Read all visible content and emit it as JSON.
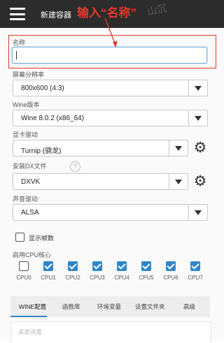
{
  "appbar": {
    "title": "新建容器",
    "annotation": "输入“名称”",
    "watermark": "山沉"
  },
  "name": {
    "label": "名称",
    "value": ""
  },
  "resolution": {
    "label": "屏幕分辨率",
    "value": "800x600 (4:3)"
  },
  "wine": {
    "label": "Wine版本",
    "value": "Wine 8.0.2 (x86_64)"
  },
  "gpu": {
    "label": "显卡驱动",
    "value": "Turnip (骁龙)"
  },
  "dx": {
    "label": "安装DX文件",
    "value": "DXVK",
    "help": "?"
  },
  "audio": {
    "label": "声音驱动",
    "value": "ALSA"
  },
  "show_fps": {
    "label": "显示帧数",
    "checked": false
  },
  "cpu": {
    "label": "启用CPU核心",
    "cores": [
      {
        "name": "CPU0",
        "checked": false
      },
      {
        "name": "CPU1",
        "checked": true
      },
      {
        "name": "CPU2",
        "checked": true
      },
      {
        "name": "CPU3",
        "checked": true
      },
      {
        "name": "CPU4",
        "checked": true
      },
      {
        "name": "CPU5",
        "checked": true
      },
      {
        "name": "CPU6",
        "checked": true
      },
      {
        "name": "CPU7",
        "checked": true
      }
    ]
  },
  "tabs": [
    "WINE配置",
    "函数库",
    "环境变量",
    "设置文件夹",
    "高级"
  ],
  "desktop_settings": {
    "label": "桌面设置"
  },
  "colors": {
    "accent": "#2f86c9",
    "annotation": "#e23a2a",
    "appbar": "#2c2c2c"
  }
}
